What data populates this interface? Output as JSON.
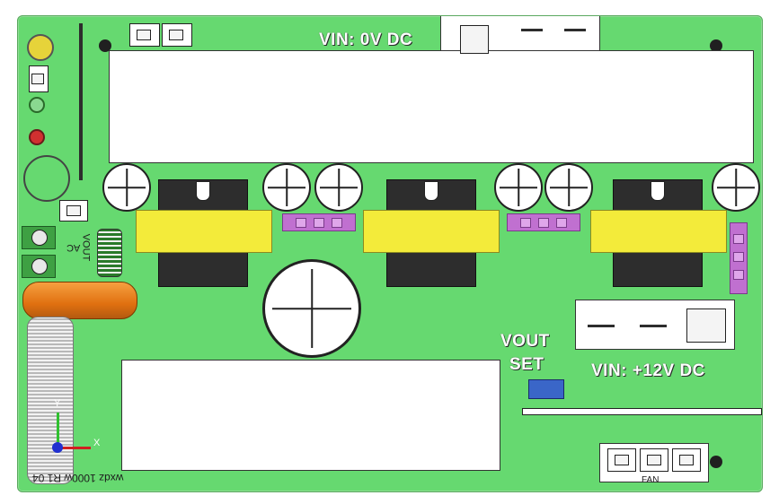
{
  "labels": {
    "vin_top": "VIN: 0V DC",
    "vin_right": "VIN: +12V DC",
    "vout_set_line1": "VOUT",
    "vout_set_line2": "SET",
    "fan": "FAN",
    "ac": "AC",
    "vout_side": "VOUT",
    "board_id": "wxdz 1000w R1 04",
    "axis_x": "X",
    "axis_y": "Y"
  },
  "colors": {
    "board": "#66d970",
    "heatsink": "#2d2d2d",
    "transformer": "#f3eb3a",
    "connector_pink": "#c070d0",
    "fuse": "#e07010",
    "trimmer": "#3a66c8"
  },
  "icons": [
    "capacitor-icon",
    "mounting-hole-icon",
    "axis-triad-icon",
    "screw-terminal-icon",
    "trimmer-pot-icon",
    "led-icon"
  ]
}
